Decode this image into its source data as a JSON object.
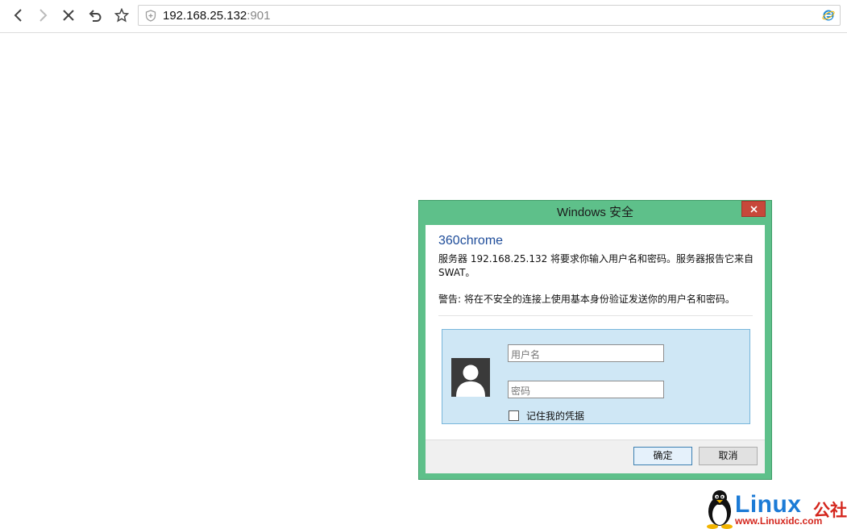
{
  "browser": {
    "url_host": "192.168.25.132",
    "url_port": ":901"
  },
  "dialog": {
    "title": "Windows 安全",
    "app_name": "360chrome",
    "message": "服务器 192.168.25.132 将要求你输入用户名和密码。服务器报告它来自 SWAT。",
    "warning": "警告: 将在不安全的连接上使用基本身份验证发送你的用户名和密码。",
    "username_placeholder": "用户名",
    "password_placeholder": "密码",
    "remember_label": "记住我的凭据",
    "ok_label": "确定",
    "cancel_label": "取消"
  },
  "watermark": {
    "brand": "Linux",
    "brand_cn": "公社",
    "site": "www.Linuxidc.com"
  },
  "colors": {
    "dialog_frame": "#5ec08a",
    "close_button": "#c7483a",
    "credential_panel": "#cfe7f5",
    "app_name": "#1f4d9a"
  }
}
